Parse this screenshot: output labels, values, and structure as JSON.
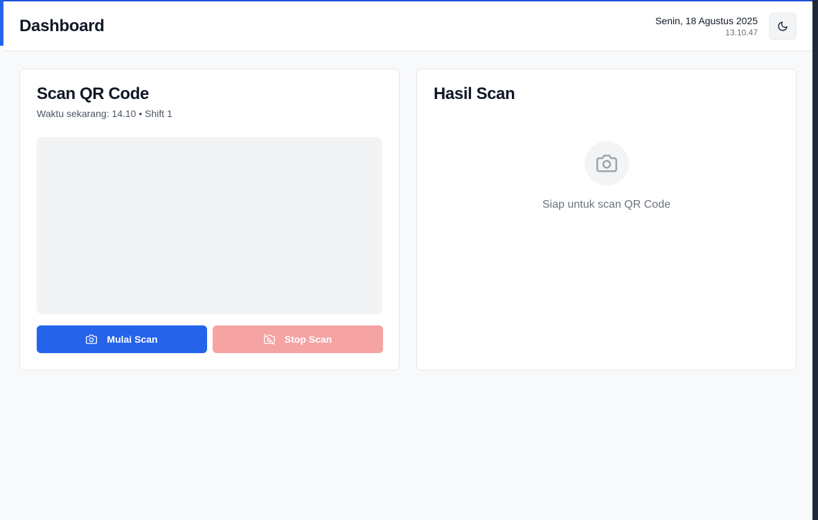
{
  "header": {
    "title": "Dashboard",
    "date": "Senin, 18 Agustus 2025",
    "time": "13.10.47",
    "theme_toggle_icon": "moon-icon"
  },
  "scan_card": {
    "title": "Scan QR Code",
    "subtitle": "Waktu sekarang: 14.10 • Shift 1",
    "start_button": {
      "label": "Mulai Scan",
      "icon": "camera-icon"
    },
    "stop_button": {
      "label": "Stop Scan",
      "icon": "camera-off-icon"
    }
  },
  "result_card": {
    "title": "Hasil Scan",
    "empty_icon": "camera-icon",
    "empty_text": "Siap untuk scan QR Code"
  },
  "colors": {
    "primary": "#2563eb",
    "stop_disabled": "#f5a3a3",
    "background": "#f8f9fb"
  }
}
